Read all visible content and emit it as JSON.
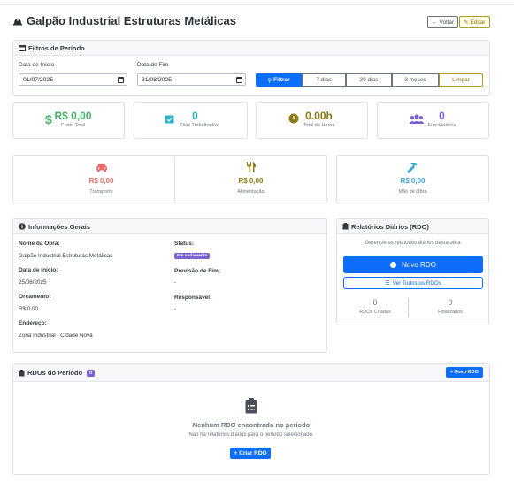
{
  "header": {
    "title": "Galpão Industrial Estruturas Metálicas",
    "back_label": "Voltar",
    "edit_label": "Editar"
  },
  "filters": {
    "title": "Filtros de Período",
    "start_label": "Data de Início",
    "start_value": "01/07/2025",
    "end_label": "Data de Fim",
    "end_value": "31/08/2025",
    "filter_label": "Filtrar",
    "d7": "7 dias",
    "d30": "30 dias",
    "m3": "3 meses",
    "clear": "Limpar"
  },
  "stats": [
    {
      "value": "R$ 0,00",
      "caption": "Custo Total",
      "color": "#4cb36b",
      "icon": "dollar-icon"
    },
    {
      "value": "0",
      "caption": "Dias Trabalhados",
      "color": "#2fb1c9",
      "icon": "calendar-check-icon"
    },
    {
      "value": "0.00h",
      "caption": "Total de Horas",
      "color": "#8d7a12",
      "icon": "clock-icon"
    },
    {
      "value": "0",
      "caption": "Funcionários",
      "color": "#7b61d6",
      "icon": "users-icon"
    }
  ],
  "expenses": [
    {
      "value": "R$ 0,00",
      "caption": "Transporte",
      "color": "#e66a6a",
      "icon": "car-icon"
    },
    {
      "value": "R$ 0,00",
      "caption": "Alimentação",
      "color": "#8d7a12",
      "icon": "utensils-icon"
    },
    {
      "value": "R$ 0,00",
      "caption": "Mão de Obra",
      "color": "#3aa6d6",
      "icon": "hammer-icon"
    }
  ],
  "info": {
    "title": "Informações Gerais",
    "name_label": "Nome da Obra:",
    "name_value": "Galpão Industrial Estruturas Metálicas",
    "status_label": "Status:",
    "status_value": "Em andamento",
    "start_label": "Data de Início:",
    "start_value": "25/08/2025",
    "forecast_label": "Previsão de Fim:",
    "forecast_value": "-",
    "budget_label": "Orçamento:",
    "budget_value": "R$ 0,00",
    "responsible_label": "Responsável:",
    "responsible_value": "-",
    "address_label": "Endereço:",
    "address_value": "Zona Industrial - Cidade Nova"
  },
  "rdo": {
    "title": "Relatórios Diários (RDO)",
    "desc": "Gerencie os relatórios diários desta obra",
    "new_label": "Novo RDO",
    "view_all_label": "Ver Todos os RDOs",
    "created_count": "0",
    "created_label": "RDOs Criados",
    "finished_count": "0",
    "finished_label": "Finalizados"
  },
  "period": {
    "title": "RDOs do Período",
    "count": "0",
    "new_label": "Novo RDO",
    "empty_title": "Nenhum RDO encontrado no período",
    "empty_desc": "Não há relatórios diários para o período selecionado.",
    "create_label": "Criar RDO"
  }
}
